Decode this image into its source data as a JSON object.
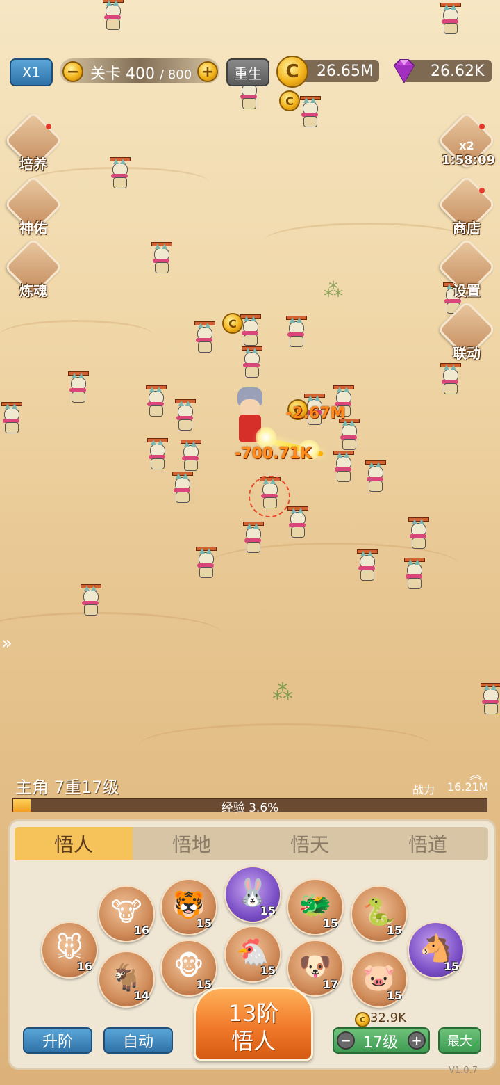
{
  "top_bar": {
    "speed_label": "X1",
    "stage_prefix": "关卡",
    "stage_current": "400",
    "stage_total": "/ 800",
    "rebirth_label": "重生",
    "gold_value": "26.65M",
    "gem_value": "26.62K"
  },
  "left_menu": [
    {
      "label": "培养"
    },
    {
      "label": "神佑"
    },
    {
      "label": "炼魂"
    }
  ],
  "right_menu": {
    "boost_multiplier": "x2",
    "boost_timer": "1:58:09",
    "shop_label": "商店",
    "settings_label": "设置",
    "link_label": "联动"
  },
  "battle": {
    "damage_1": "-2.67M",
    "damage_2": "-700.71K",
    "expand_arrow": "»"
  },
  "hero": {
    "title": "主角 7重17级",
    "power_label": "战力",
    "power_value": "16.21M",
    "exp_label": "经验 3.6%",
    "exp_progress": 0.036
  },
  "tabs": [
    {
      "label": "悟人",
      "active": true
    },
    {
      "label": "悟地",
      "active": false
    },
    {
      "label": "悟天",
      "active": false
    },
    {
      "label": "悟道",
      "active": false
    }
  ],
  "zodiac": [
    {
      "name": "rat",
      "glyph": "🐭",
      "level": "16"
    },
    {
      "name": "ox",
      "glyph": "🐮",
      "level": "16"
    },
    {
      "name": "goat",
      "glyph": "🐐",
      "level": "14"
    },
    {
      "name": "tiger",
      "glyph": "🐯",
      "level": "15"
    },
    {
      "name": "monkey",
      "glyph": "🐵",
      "level": "15"
    },
    {
      "name": "rabbit",
      "glyph": "🐰",
      "level": "15",
      "highlight": true
    },
    {
      "name": "rooster",
      "glyph": "🐔",
      "level": "15"
    },
    {
      "name": "dragon",
      "glyph": "🐲",
      "level": "15"
    },
    {
      "name": "dog",
      "glyph": "🐶",
      "level": "17"
    },
    {
      "name": "snake",
      "glyph": "🐍",
      "level": "15"
    },
    {
      "name": "pig",
      "glyph": "🐷",
      "level": "15"
    },
    {
      "name": "horse",
      "glyph": "🐴",
      "level": "15",
      "highlight": true
    }
  ],
  "bottom": {
    "upgrade_label": "升阶",
    "auto_label": "自动",
    "main_line1": "13阶",
    "main_line2": "悟人",
    "cost_value": "32.9K",
    "level_value": "17级",
    "max_label": "最大",
    "version": "V1.0.7"
  },
  "colors": {
    "accent_orange": "#f07a2a",
    "tab_active": "#f6c25a",
    "btn_blue": "#2f72a8",
    "btn_green": "#3e9a52"
  }
}
